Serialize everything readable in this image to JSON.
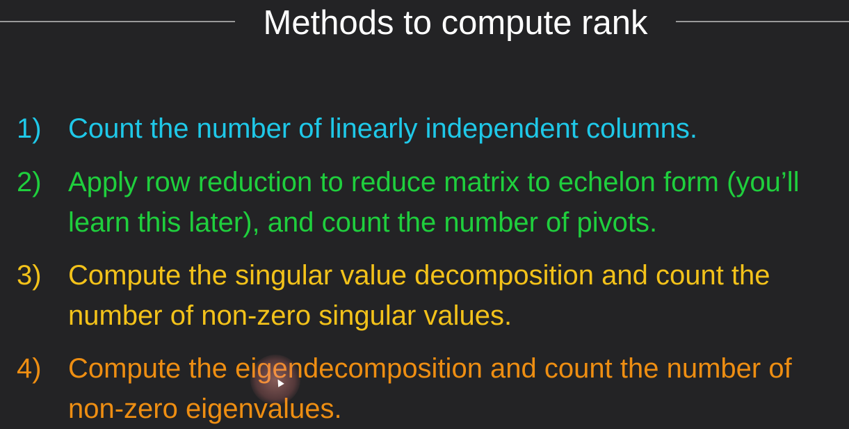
{
  "slide": {
    "title": "Methods to compute rank",
    "items": [
      {
        "number": "1)",
        "lines": [
          "Count the number of linearly independent columns."
        ],
        "color": "#1fc8e8"
      },
      {
        "number": "2)",
        "lines": [
          "Apply row reduction to reduce matrix to echelon form (you’ll",
          "learn this later), and count the number of pivots."
        ],
        "color": "#1fcf3d"
      },
      {
        "number": "3)",
        "lines": [
          "Compute the singular value decomposition and count the",
          "number of non-zero singular values."
        ],
        "color": "#f3c21a"
      },
      {
        "number": "4)",
        "lines": [
          "Compute the eigendecomposition and count the number of",
          "non-zero eigenvalues."
        ],
        "color": "#ee8e12"
      }
    ]
  },
  "colors": {
    "background": "#232325",
    "title": "#ffffff",
    "rule": "#9a9a9a"
  },
  "cursor": {
    "icon": "mouse-pointer-icon"
  }
}
